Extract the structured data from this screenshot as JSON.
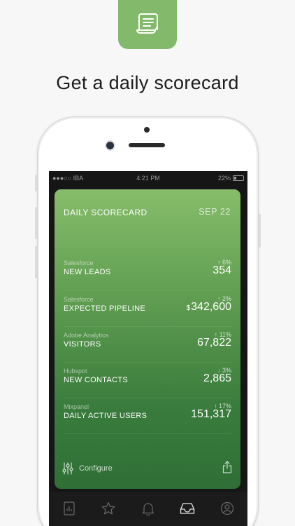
{
  "headline": "Get a daily scorecard",
  "status_bar": {
    "carrier": "●●●○○ IBA",
    "time": "4:21 PM",
    "battery": "22%"
  },
  "scorecard": {
    "title": "DAILY SCORECARD",
    "date": "SEP 22",
    "metrics": [
      {
        "source": "Salesforce",
        "label": "NEW LEADS",
        "change": "↑ 6%",
        "prefix": "",
        "value": "354"
      },
      {
        "source": "Salesforce",
        "label": "EXPECTED PIPELINE",
        "change": "↑ 2%",
        "prefix": "$",
        "value": "342,600"
      },
      {
        "source": "Adobe Analytics",
        "label": "VISITORS",
        "change": "↑ 11%",
        "prefix": "",
        "value": "67,822"
      },
      {
        "source": "Hubspot",
        "label": "NEW CONTACTS",
        "change": "↓ 3%",
        "prefix": "",
        "value": "2,865"
      },
      {
        "source": "Mixpanel",
        "label": "DAILY ACTIVE USERS",
        "change": "↑ 17%",
        "prefix": "",
        "value": "151,317"
      }
    ],
    "configure_label": "Configure"
  },
  "tabs": [
    {
      "icon": "reports-icon"
    },
    {
      "icon": "star-icon"
    },
    {
      "icon": "bell-icon"
    },
    {
      "icon": "inbox-icon",
      "active": true
    },
    {
      "icon": "profile-icon"
    }
  ],
  "colors": {
    "brand_green": "#82b96a",
    "card_top": "#86bd6a",
    "card_bottom": "#2f6f36",
    "tab_active": "#e8e8e8",
    "tab_inactive": "#6a6a6a"
  }
}
